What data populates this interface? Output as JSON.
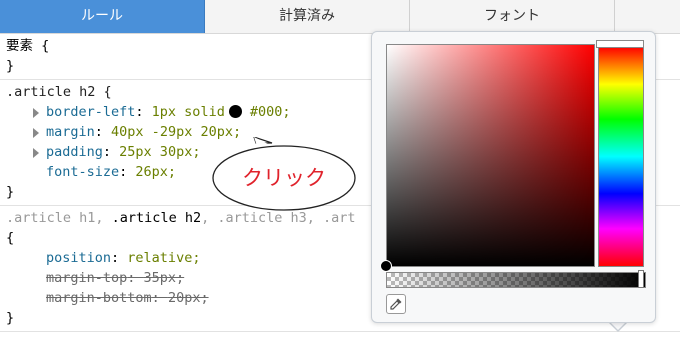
{
  "tabs": [
    {
      "label": "ルール",
      "active": true
    },
    {
      "label": "計算済み",
      "active": false
    },
    {
      "label": "フォント",
      "active": false
    }
  ],
  "rules": {
    "element": {
      "open": "要素 {",
      "close": "}"
    },
    "h2": {
      "selector": ".article h2 {",
      "border_left": {
        "prop": "border-left",
        "value_before": "1px solid",
        "value_after": "#000;"
      },
      "margin": {
        "prop": "margin",
        "value": "40px -29px 20px;"
      },
      "padding": {
        "prop": "padding",
        "value": "25px 30px;"
      },
      "font_size": {
        "prop": "font-size",
        "value": "26px;"
      },
      "close": "}"
    },
    "heading": {
      "selector_pre": ".article h1, ",
      "selector_bold": ".article h2",
      "selector_post": ", .article h3, .art",
      "open": "{",
      "position": {
        "prop": "position",
        "value": "relative;"
      },
      "margin_top": {
        "prop": "margin-top",
        "value": "35px;"
      },
      "margin_bottom": {
        "prop": "margin-bottom",
        "value": "20px;"
      },
      "close": "}"
    }
  },
  "callout": {
    "text": "クリック",
    "color": "#e0222b"
  },
  "color_picker": {
    "current_color": "#000000",
    "hue_color": "#ff0000"
  },
  "icons": {
    "eyedropper": "eyedropper-icon",
    "expand": "expand-triangle-icon"
  }
}
